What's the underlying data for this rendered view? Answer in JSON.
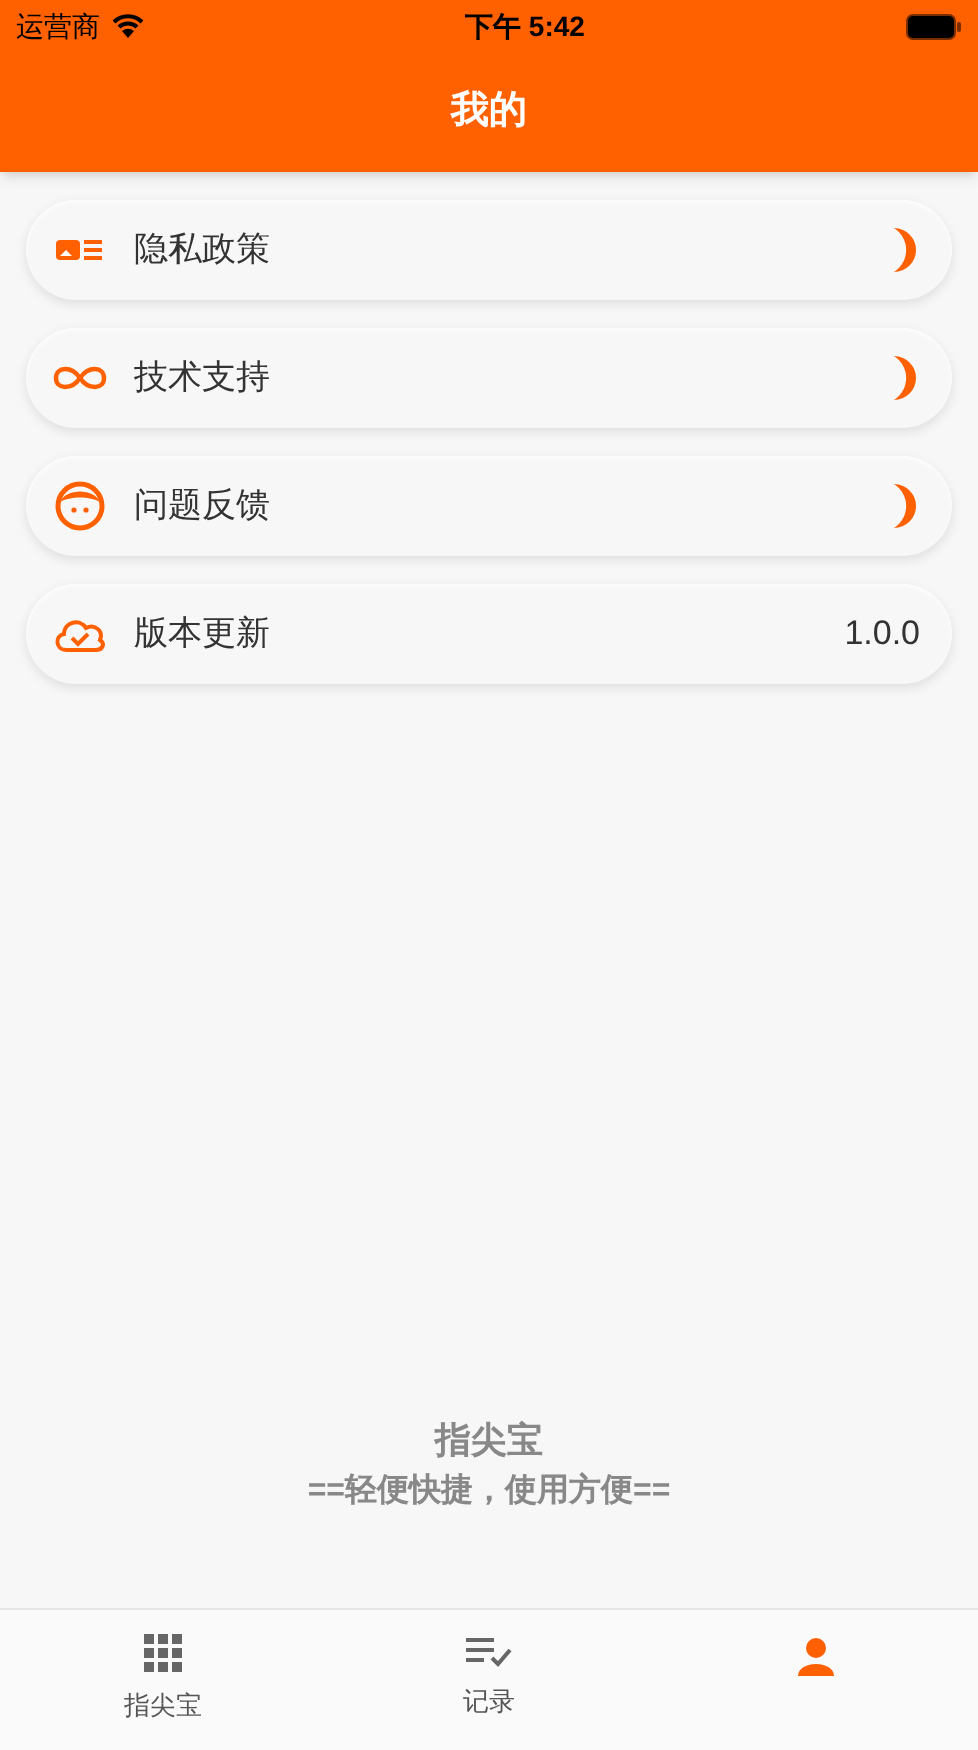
{
  "status_bar": {
    "carrier": "运营商",
    "time": "下午 5:42"
  },
  "header": {
    "title": "我的"
  },
  "menu": [
    {
      "label": "隐私政策",
      "kind": "link"
    },
    {
      "label": "技术支持",
      "kind": "link"
    },
    {
      "label": "问题反馈",
      "kind": "link"
    },
    {
      "label": "版本更新",
      "kind": "value",
      "value": "1.0.0"
    }
  ],
  "footer": {
    "app_name": "指尖宝",
    "slogan": "==轻便快捷，使用方便=="
  },
  "tab_bar": [
    {
      "label": "指尖宝",
      "selected": false
    },
    {
      "label": "记录",
      "selected": false
    },
    {
      "selected": true
    }
  ]
}
